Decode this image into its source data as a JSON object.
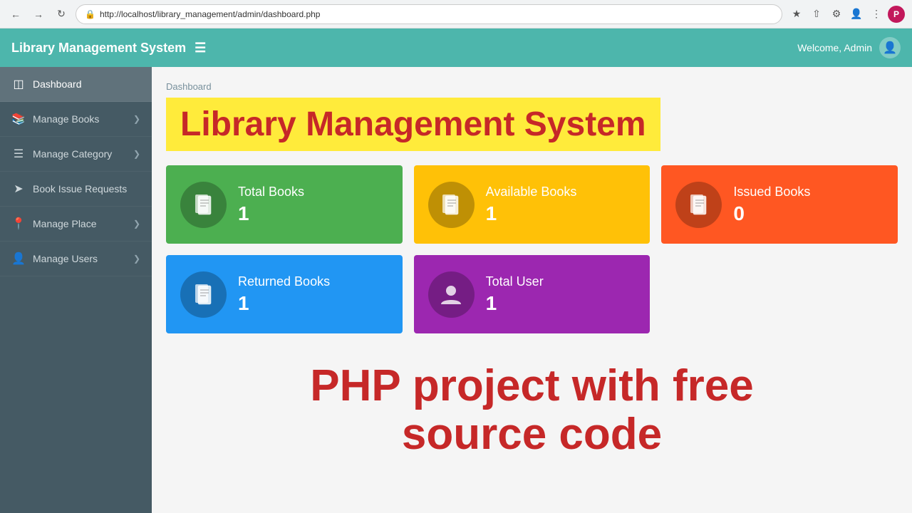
{
  "browser": {
    "url": "http://localhost/library_management/admin/dashboard.php",
    "profile_initial": "P"
  },
  "navbar": {
    "brand": "Library Management System",
    "hamburger": "☰",
    "welcome_text": "Welcome, Admin"
  },
  "sidebar": {
    "items": [
      {
        "id": "dashboard",
        "icon": "⊞",
        "label": "Dashboard",
        "has_arrow": false
      },
      {
        "id": "manage-books",
        "icon": "📚",
        "label": "Manage Books",
        "has_arrow": true
      },
      {
        "id": "manage-category",
        "icon": "☰",
        "label": "Manage Category",
        "has_arrow": true
      },
      {
        "id": "book-issue-requests",
        "icon": "✈",
        "label": "Book Issue Requests",
        "has_arrow": false
      },
      {
        "id": "manage-place",
        "icon": "📍",
        "label": "Manage Place",
        "has_arrow": true
      },
      {
        "id": "manage-users",
        "icon": "👤",
        "label": "Manage Users",
        "has_arrow": true
      }
    ]
  },
  "content": {
    "breadcrumb": "Dashboard",
    "title": "Library Management System",
    "stats": [
      {
        "id": "total-books",
        "label": "Total Books",
        "value": "1",
        "color": "green",
        "icon": "book"
      },
      {
        "id": "available-books",
        "label": "Available Books",
        "value": "1",
        "color": "yellow",
        "icon": "book"
      },
      {
        "id": "issued-books",
        "label": "Issued Books",
        "value": "0",
        "color": "orange",
        "icon": "book"
      },
      {
        "id": "returned-books",
        "label": "Returned Books",
        "value": "1",
        "color": "blue",
        "icon": "book"
      },
      {
        "id": "total-user",
        "label": "Total User",
        "value": "1",
        "color": "purple",
        "icon": "person"
      }
    ],
    "footer_text_line1": "PHP project with free",
    "footer_text_line2": "source code"
  }
}
